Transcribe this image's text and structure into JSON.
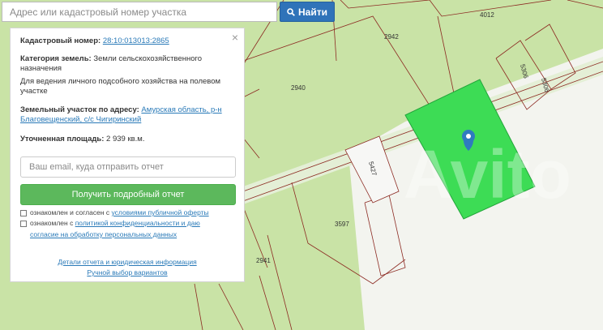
{
  "search": {
    "placeholder": "Адрес или кадастровый номер участка",
    "button_label": "Найти",
    "button_icon": "search-icon"
  },
  "map": {
    "parcel_labels": [
      "4012",
      "2942",
      "5306",
      "5306",
      "2940",
      "5427",
      "3597",
      "2941"
    ],
    "marker_icon": "map-marker-icon",
    "selected_parcel_color": "#3ddc55"
  },
  "panel": {
    "close_label": "×",
    "cadastral": {
      "label": "Кадастровый номер:",
      "value": "28:10:013013:2865"
    },
    "category": {
      "label": "Категория земель:",
      "value": "Земли сельскохозяйственного назначения"
    },
    "usage": "Для ведения личного подсобного хозяйства на полевом участке",
    "address": {
      "label": "Земельный участок по адресу:",
      "line1": "Амурская область, р-н",
      "line2": "Благовещенский, с/с Чигиринский"
    },
    "area": {
      "label": "Уточненная площадь:",
      "value": "2 939 кв.м."
    },
    "email_placeholder": "Ваш email, куда отправить отчет",
    "report_button": "Получить подробный отчет",
    "agree1": {
      "prefix": "ознакомлен и согласен с ",
      "link": "условиями публичной оферты"
    },
    "agree2": {
      "prefix": "ознакомлен с ",
      "link1": "политикой конфиденциальности и даю",
      "link2": "согласие на обработку персональных данных"
    },
    "footer_link1": "Детали отчета и юридическая информация",
    "footer_link2": "Ручной выбор вариантов"
  },
  "watermark": "Avito"
}
